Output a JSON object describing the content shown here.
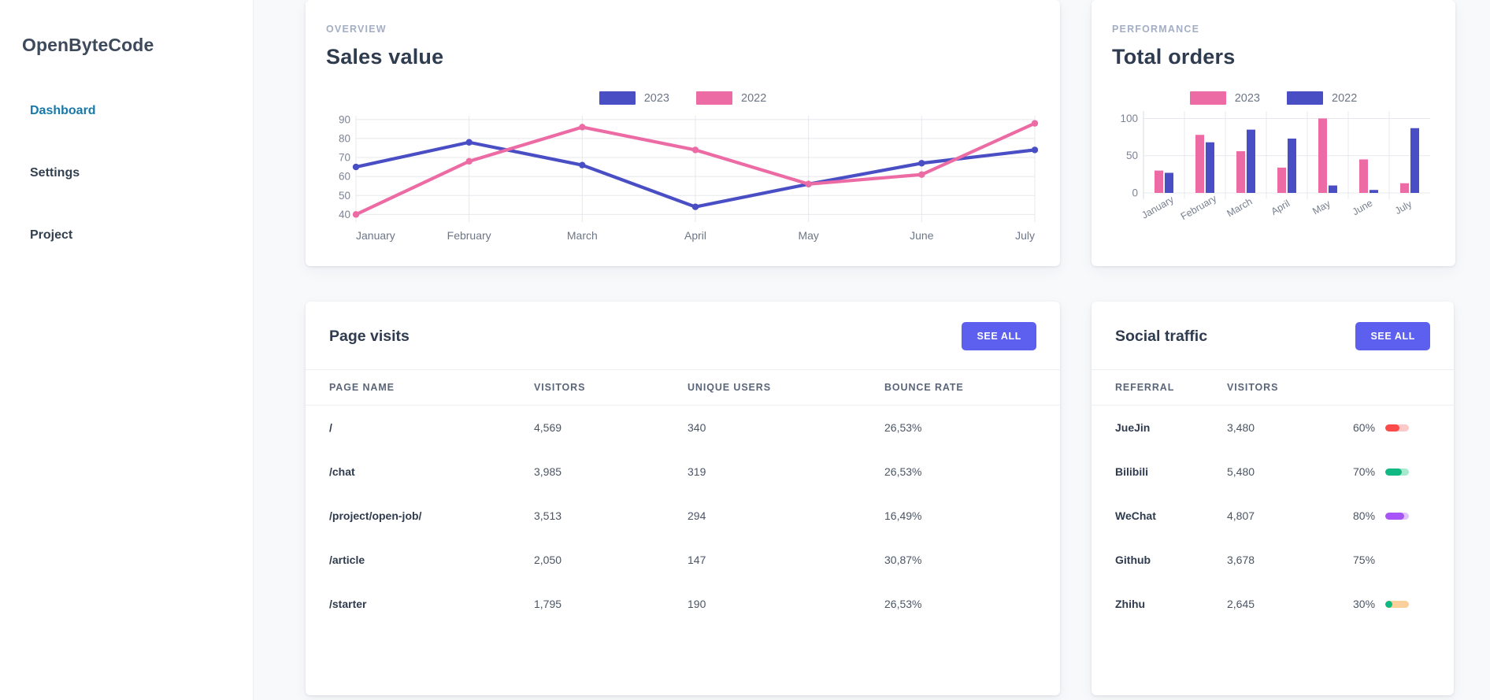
{
  "sidebar": {
    "brand": "OpenByteCode",
    "items": [
      {
        "label": "Dashboard",
        "active": true
      },
      {
        "label": "Settings",
        "active": false
      },
      {
        "label": "Project",
        "active": false
      }
    ]
  },
  "colors": {
    "blue_2022": "#4a4ec4",
    "pink": "#ec6ba4",
    "accent_button": "#5d5fef",
    "active_nav": "#1878a8",
    "title": "#2f3b4e",
    "eyebrow": "#a3aec4"
  },
  "sales_card": {
    "eyebrow": "OVERVIEW",
    "title": "Sales value"
  },
  "orders_card": {
    "eyebrow": "PERFORMANCE",
    "title": "Total orders"
  },
  "page_visits": {
    "title": "Page visits",
    "see_all_label": "SEE ALL",
    "columns": [
      "PAGE NAME",
      "VISITORS",
      "UNIQUE USERS",
      "BOUNCE RATE"
    ],
    "rows": [
      {
        "page": "/",
        "visitors": "4,569",
        "unique": "340",
        "bounce": "26,53%"
      },
      {
        "page": "/chat",
        "visitors": "3,985",
        "unique": "319",
        "bounce": "26,53%"
      },
      {
        "page": "/project/open-job/",
        "visitors": "3,513",
        "unique": "294",
        "bounce": "16,49%"
      },
      {
        "page": "/article",
        "visitors": "2,050",
        "unique": "147",
        "bounce": "30,87%"
      },
      {
        "page": "/starter",
        "visitors": "1,795",
        "unique": "190",
        "bounce": "26,53%"
      }
    ]
  },
  "social_traffic": {
    "title": "Social traffic",
    "see_all_label": "SEE ALL",
    "columns": [
      "REFERRAL",
      "VISITORS"
    ],
    "rows": [
      {
        "referral": "JueJin",
        "visitors": "3,480",
        "percent": "60%",
        "value": 60,
        "fill": "#fb4a4a",
        "track": "#fcc9c9",
        "has_bar": true
      },
      {
        "referral": "Bilibili",
        "visitors": "5,480",
        "percent": "70%",
        "value": 70,
        "fill": "#10b981",
        "track": "#a7e9cf",
        "has_bar": true
      },
      {
        "referral": "WeChat",
        "visitors": "4,807",
        "percent": "80%",
        "value": 80,
        "fill": "#a855f7",
        "track": "#ddc5fb",
        "has_bar": true
      },
      {
        "referral": "Github",
        "visitors": "3,678",
        "percent": "75%",
        "value": 75,
        "fill": "#10b981",
        "track": "#e4e7ec",
        "has_bar": false
      },
      {
        "referral": "Zhihu",
        "visitors": "2,645",
        "percent": "30%",
        "value": 30,
        "fill": "#10b981",
        "track": "#f9cf9a",
        "has_bar": true
      }
    ]
  },
  "chart_data": [
    {
      "type": "line",
      "title": "Sales value",
      "xlabel": "",
      "ylabel": "",
      "categories": [
        "January",
        "February",
        "March",
        "April",
        "May",
        "June",
        "July"
      ],
      "yticks": [
        40,
        50,
        60,
        70,
        80,
        90
      ],
      "ylim": [
        36,
        92
      ],
      "grid": true,
      "legend_position": "top-center",
      "series": [
        {
          "name": "2023",
          "color": "#4a4ec4",
          "values": [
            65,
            78,
            66,
            44,
            56,
            67,
            74
          ]
        },
        {
          "name": "2022",
          "color": "#ec6ba4",
          "values": [
            40,
            68,
            86,
            74,
            56,
            61,
            88
          ]
        }
      ]
    },
    {
      "type": "bar",
      "title": "Total orders",
      "xlabel": "",
      "ylabel": "",
      "categories": [
        "January",
        "February",
        "March",
        "April",
        "May",
        "June",
        "July"
      ],
      "yticks": [
        0,
        50,
        100
      ],
      "ylim": [
        0,
        110
      ],
      "grid": true,
      "legend_position": "top-center",
      "series": [
        {
          "name": "2023",
          "color": "#ec6ba4",
          "values": [
            30,
            78,
            56,
            34,
            100,
            45,
            13
          ]
        },
        {
          "name": "2022",
          "color": "#4a4ec4",
          "values": [
            27,
            68,
            85,
            73,
            10,
            4,
            87
          ]
        }
      ]
    }
  ]
}
